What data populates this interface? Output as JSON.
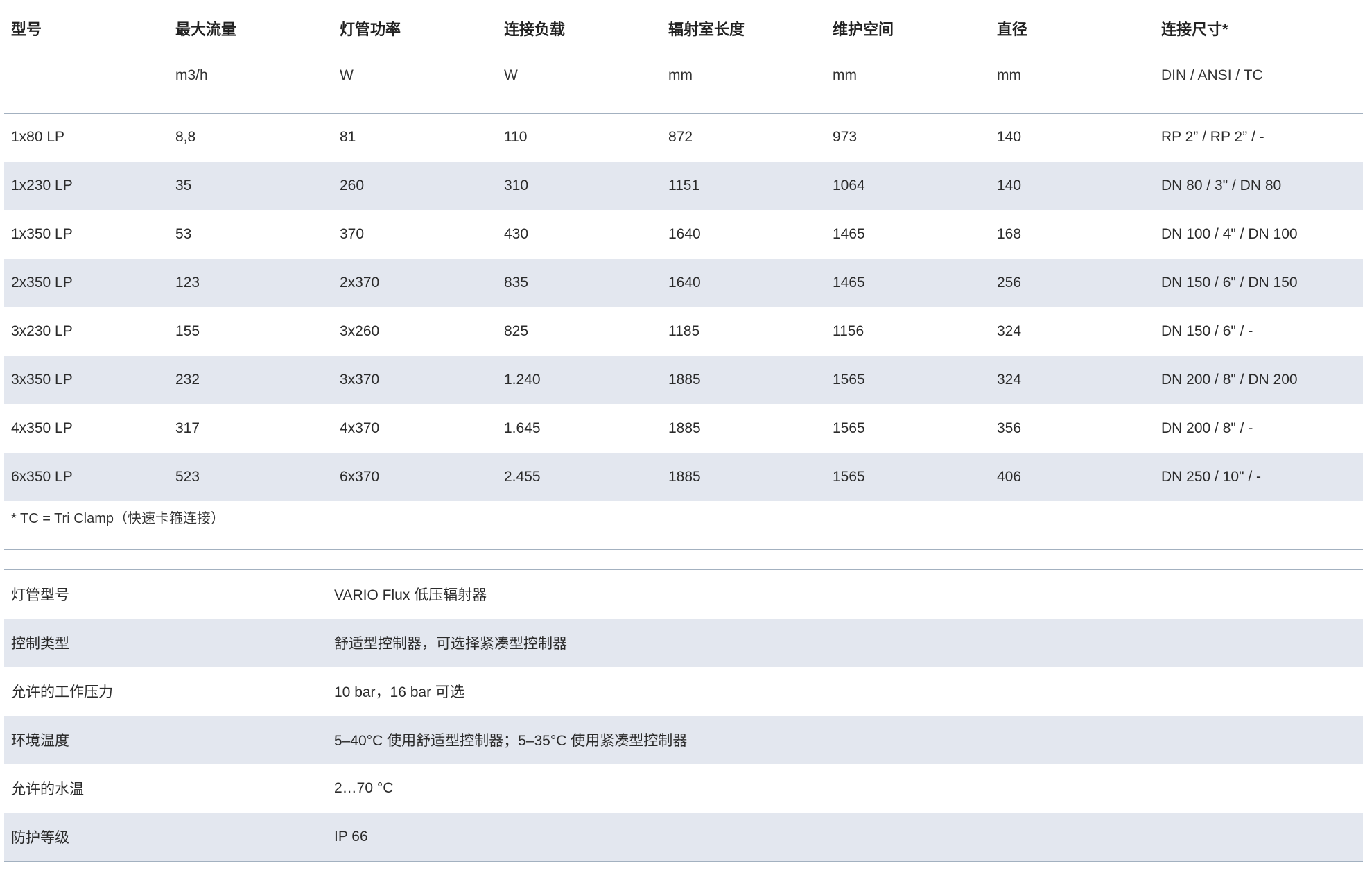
{
  "specs": {
    "headers": [
      "型号",
      "最大流量",
      "灯管功率",
      "连接负载",
      "辐射室长度",
      "维护空间",
      "直径",
      "连接尺寸*"
    ],
    "units": [
      "",
      "m3/h",
      "W",
      "W",
      "mm",
      "mm",
      "mm",
      "DIN / ANSI / TC"
    ],
    "rows": [
      [
        "1x80 LP",
        "8,8",
        "81",
        "110",
        "872",
        "973",
        "140",
        "RP 2” / RP 2” / -"
      ],
      [
        "1x230 LP",
        "35",
        "260",
        "310",
        "1151",
        "1064",
        "140",
        "DN 80 / 3\" / DN 80"
      ],
      [
        "1x350 LP",
        "53",
        "370",
        "430",
        "1640",
        "1465",
        "168",
        "DN 100 / 4\" / DN 100"
      ],
      [
        "2x350 LP",
        "123",
        "2x370",
        "835",
        "1640",
        "1465",
        "256",
        "DN 150 / 6\" / DN 150"
      ],
      [
        "3x230 LP",
        "155",
        "3x260",
        "825",
        "1185",
        "1156",
        "324",
        "DN 150 / 6\" / -"
      ],
      [
        "3x350 LP",
        "232",
        "3x370",
        "1.240",
        "1885",
        "1565",
        "324",
        "DN 200 / 8\" / DN 200"
      ],
      [
        "4x350 LP",
        "317",
        "4x370",
        "1.645",
        "1885",
        "1565",
        "356",
        "DN 200 / 8\" / -"
      ],
      [
        "6x350 LP",
        "523",
        "6x370",
        "2.455",
        "1885",
        "1565",
        "406",
        "DN 250 / 10\" / -"
      ]
    ],
    "footnote": "* TC = Tri Clamp（快速卡箍连接）"
  },
  "properties": [
    {
      "label": "灯管型号",
      "value": "VARIO Flux 低压辐射器"
    },
    {
      "label": "控制类型",
      "value": "舒适型控制器，可选择紧凑型控制器"
    },
    {
      "label": "允许的工作压力",
      "value": "10 bar，16 bar 可选"
    },
    {
      "label": "环境温度",
      "value": "5–40°C 使用舒适型控制器；5–35°C 使用紧凑型控制器"
    },
    {
      "label": "允许的水温",
      "value": "2…70 °C"
    },
    {
      "label": "防护等级",
      "value": "IP 66"
    }
  ],
  "colors": {
    "row_shade": "#e3e7ef",
    "rule": "#a3b1c0"
  }
}
